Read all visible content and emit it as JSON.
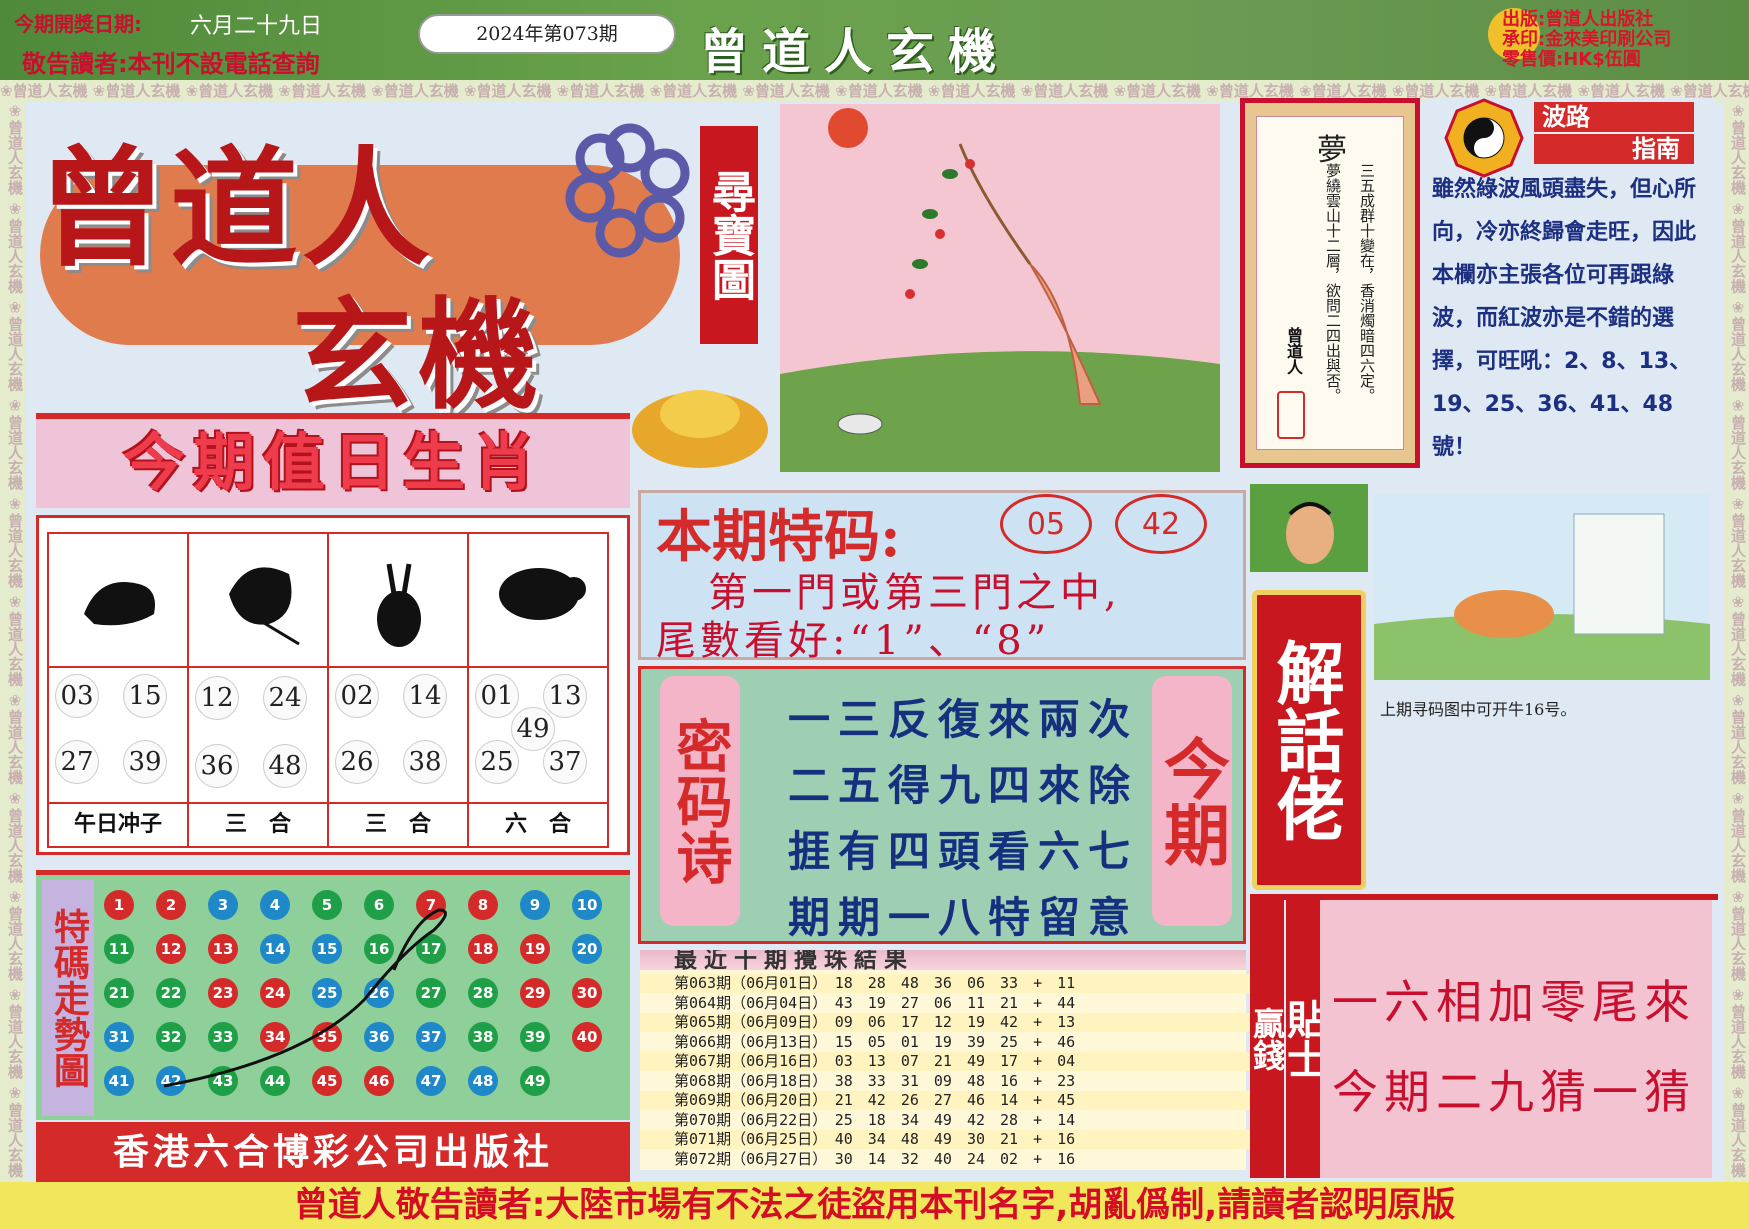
{
  "header": {
    "draw_date_label": "今期開獎日期:",
    "draw_date": "六月二十九日",
    "notice": "敬告讀者:本刊不設電話查詢",
    "issue": "2024年第073期",
    "title": "曾道人玄機",
    "publisher": "出版:曾道人出版社",
    "printer": "承印:金來美印刷公司",
    "price": "零售價:HK$伍圓"
  },
  "strip_text": "曾道人玄機",
  "logo": {
    "main": "曾道人",
    "sub": "玄機",
    "side_box": "尋寶圖"
  },
  "zodiac": {
    "title": "今期值日生肖",
    "animals": [
      {
        "icon": "tiger-icon",
        "numbers": [
          "03",
          "15",
          "27",
          "39"
        ],
        "label": "午日冲子"
      },
      {
        "icon": "ox-icon",
        "numbers": [
          "12",
          "24",
          "36",
          "48"
        ],
        "label": "三　合"
      },
      {
        "icon": "rabbit-icon",
        "numbers": [
          "02",
          "14",
          "26",
          "38"
        ],
        "label": "三　合"
      },
      {
        "icon": "rat-icon",
        "numbers": [
          "01",
          "13",
          "49",
          "25",
          "37"
        ],
        "label": "六　合"
      }
    ]
  },
  "trend": {
    "label": "特碼走勢圖",
    "balls": [
      {
        "n": "1",
        "c": "#d42a2a"
      },
      {
        "n": "2",
        "c": "#d42a2a"
      },
      {
        "n": "3",
        "c": "#1e88c8"
      },
      {
        "n": "4",
        "c": "#1e88c8"
      },
      {
        "n": "5",
        "c": "#1fa048"
      },
      {
        "n": "6",
        "c": "#1fa048"
      },
      {
        "n": "7",
        "c": "#d42a2a"
      },
      {
        "n": "8",
        "c": "#d42a2a"
      },
      {
        "n": "9",
        "c": "#1e88c8"
      },
      {
        "n": "10",
        "c": "#1e88c8"
      },
      {
        "n": "11",
        "c": "#1fa048"
      },
      {
        "n": "12",
        "c": "#d42a2a"
      },
      {
        "n": "13",
        "c": "#d42a2a"
      },
      {
        "n": "14",
        "c": "#1e88c8"
      },
      {
        "n": "15",
        "c": "#1e88c8"
      },
      {
        "n": "16",
        "c": "#1fa048"
      },
      {
        "n": "17",
        "c": "#1fa048"
      },
      {
        "n": "18",
        "c": "#d42a2a"
      },
      {
        "n": "19",
        "c": "#d42a2a"
      },
      {
        "n": "20",
        "c": "#1e88c8"
      },
      {
        "n": "21",
        "c": "#1fa048"
      },
      {
        "n": "22",
        "c": "#1fa048"
      },
      {
        "n": "23",
        "c": "#d42a2a"
      },
      {
        "n": "24",
        "c": "#d42a2a"
      },
      {
        "n": "25",
        "c": "#1e88c8"
      },
      {
        "n": "26",
        "c": "#1e88c8"
      },
      {
        "n": "27",
        "c": "#1fa048"
      },
      {
        "n": "28",
        "c": "#1fa048"
      },
      {
        "n": "29",
        "c": "#d42a2a"
      },
      {
        "n": "30",
        "c": "#d42a2a"
      },
      {
        "n": "31",
        "c": "#1e88c8"
      },
      {
        "n": "32",
        "c": "#1fa048"
      },
      {
        "n": "33",
        "c": "#1fa048"
      },
      {
        "n": "34",
        "c": "#d42a2a"
      },
      {
        "n": "35",
        "c": "#d42a2a"
      },
      {
        "n": "36",
        "c": "#1e88c8"
      },
      {
        "n": "37",
        "c": "#1e88c8"
      },
      {
        "n": "38",
        "c": "#1fa048"
      },
      {
        "n": "39",
        "c": "#1fa048"
      },
      {
        "n": "40",
        "c": "#d42a2a"
      },
      {
        "n": "41",
        "c": "#1e88c8"
      },
      {
        "n": "42",
        "c": "#1e88c8"
      },
      {
        "n": "43",
        "c": "#1fa048"
      },
      {
        "n": "44",
        "c": "#1fa048"
      },
      {
        "n": "45",
        "c": "#d42a2a"
      },
      {
        "n": "46",
        "c": "#d42a2a"
      },
      {
        "n": "47",
        "c": "#1e88c8"
      },
      {
        "n": "48",
        "c": "#1e88c8"
      },
      {
        "n": "49",
        "c": "#1fa048"
      }
    ],
    "footer": "香港六合博彩公司出版社"
  },
  "special_code": {
    "title": "本期特码:",
    "numbers": [
      "05",
      "42"
    ],
    "line1": "第一門或第三門之中,",
    "line2": "尾數看好:“1”、“8”"
  },
  "poem": {
    "left_label": "密码诗",
    "right_label": "今期",
    "lines": [
      "一三反復來兩次",
      "二五得九四來除",
      "�js有四頭看六七",
      "期期一八特留意"
    ]
  },
  "results": {
    "title": "最近十期攪珠結果",
    "rows": [
      "第063期（06月01日）　18　28　48　36　06　33　+　11",
      "第064期（06月04日）　43　19　27　06　11　21　+　44",
      "第065期（06月09日）　09　06　17　12　19　42　+　13",
      "第066期（06月13日）　15　05　01　19　39　25　+　46",
      "第067期（06月16日）　03　13　07　21　49　17　+　04",
      "第068期（06月18日）　38　33　31　09　48　16　+　23",
      "第069期（06月20日）　21　42　26　27　46　14　+　45",
      "第070期（06月22日）　25　18　34　49　42　28　+　14",
      "第071期（06月25日）　40　34　48　49　30　21　+　16",
      "第072期（06月27日）　30　14　32　40　24　02　+　16"
    ]
  },
  "dream": {
    "title": "夢",
    "col1": "三五成群十變在，香消燭暗四六定。",
    "col2": "夢繞雲山十二層，欲問二四出與否。",
    "signature": "曾道人"
  },
  "bolu": {
    "label_top": "波路",
    "label_bottom": "指南",
    "text": "雖然綠波風頭盡失，但心所向，冷亦終歸會走旺，因此本欄亦主張各位可再跟綠波，而紅波亦是不錯的選擇，可旺吼：2、8、13、19、25、36、41、48號！"
  },
  "caption": "上期寻码图中可开牛16号。",
  "jiehua": "解話佬",
  "tie": {
    "label_a": "贏錢",
    "label_b": "貼士",
    "line1": "一六相加零尾來",
    "line2": "今期二九猜一猜"
  },
  "footer": "曾道人敬告讀者:大陸市場有不法之徒盜用本刊名字,胡亂僞制,請讀者認明原版"
}
